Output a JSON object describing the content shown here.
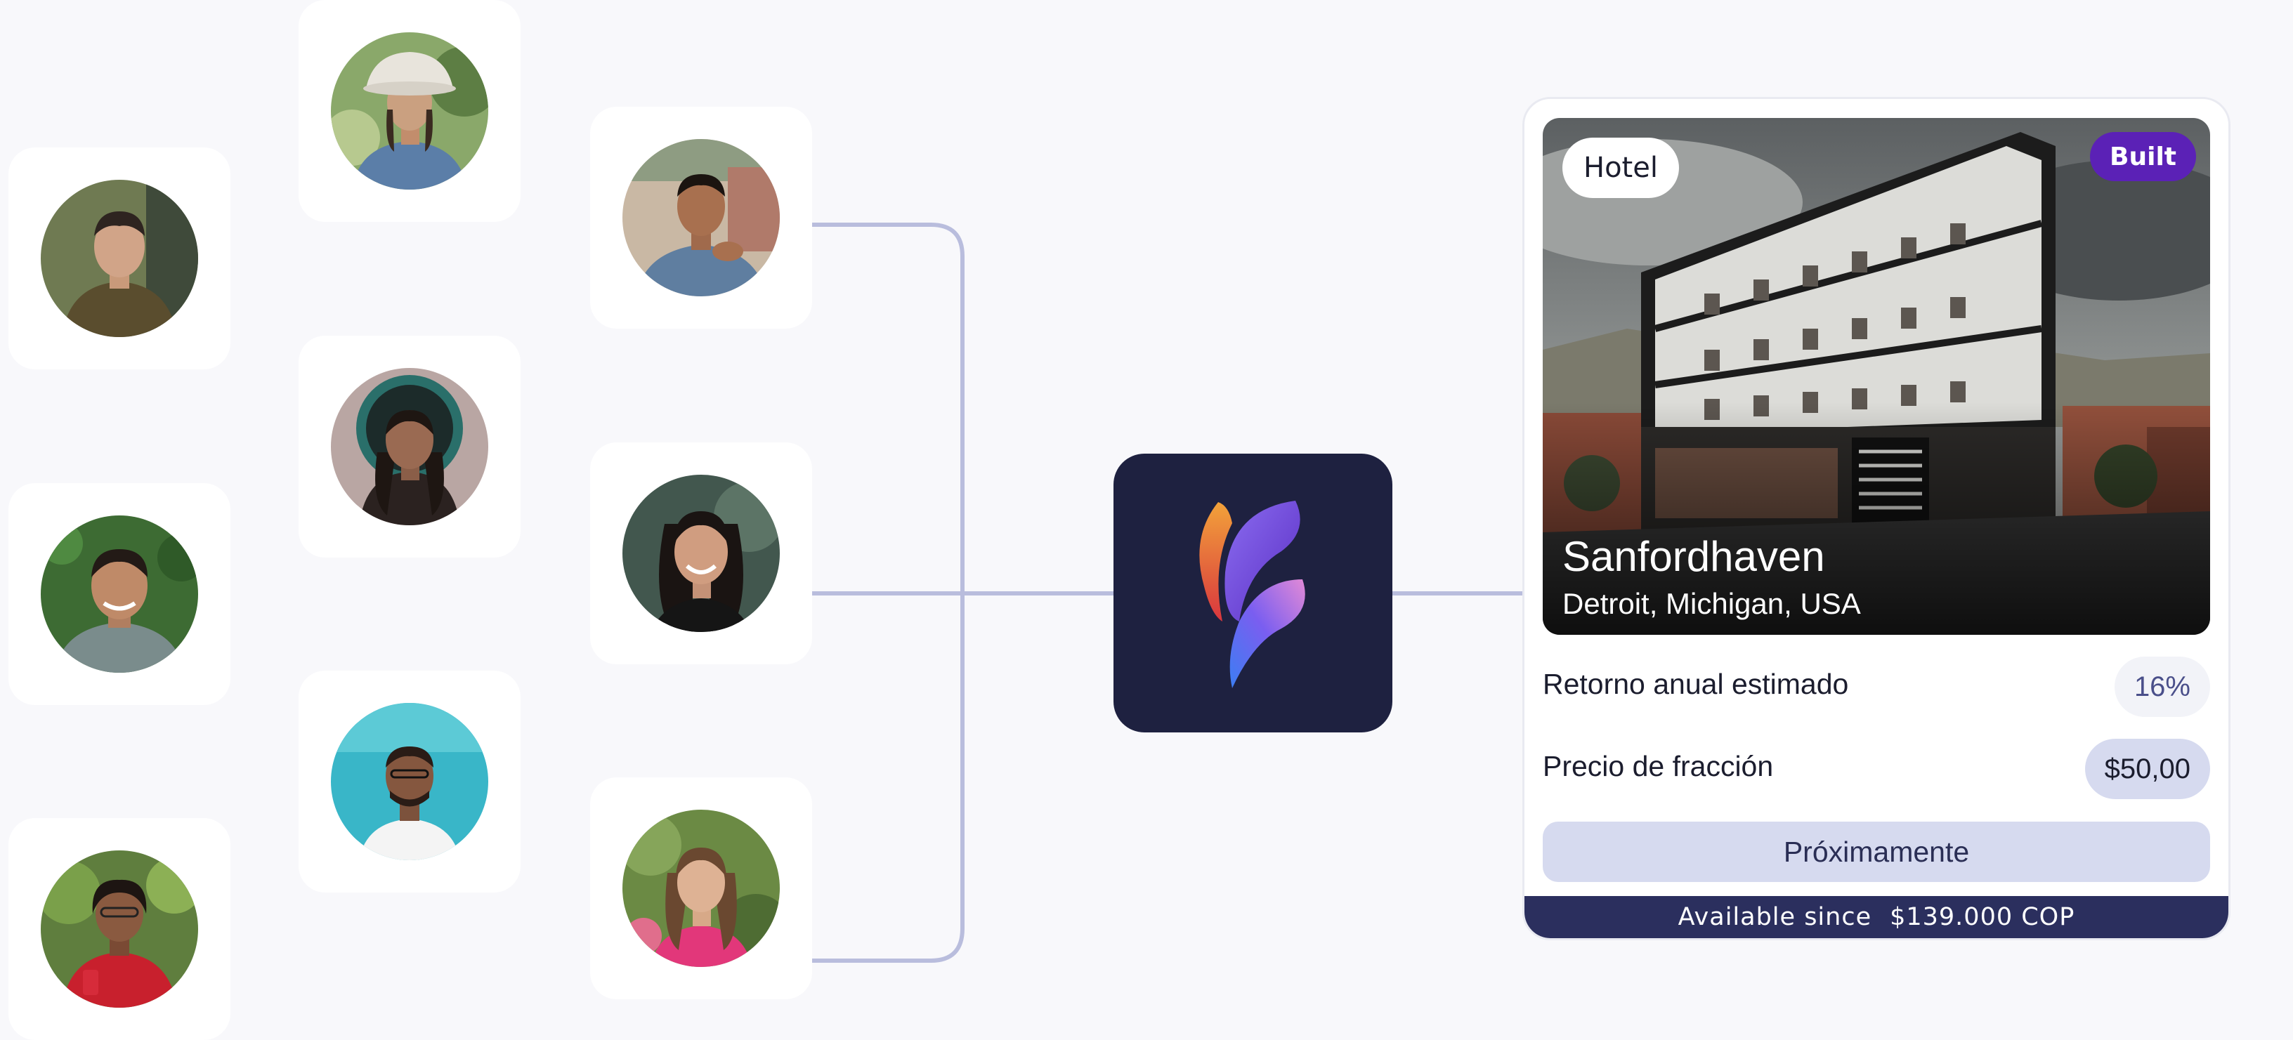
{
  "colors": {
    "background": "#f8f8fb",
    "connector": "#b9bddd",
    "logo_bg": "#1e2140",
    "badge": "#5b21b6",
    "footer": "#2b2f5e",
    "button": "#d6daef"
  },
  "avatars": [
    {
      "name": "avatar-man-jacket"
    },
    {
      "name": "avatar-man-green-background"
    },
    {
      "name": "avatar-woman-red-dress"
    },
    {
      "name": "avatar-woman-bucket-hat"
    },
    {
      "name": "avatar-woman-headdress"
    },
    {
      "name": "avatar-man-beach"
    },
    {
      "name": "avatar-man-street"
    },
    {
      "name": "avatar-woman-smiling"
    },
    {
      "name": "avatar-woman-garden"
    }
  ],
  "logo": {
    "icon": "feather-logo-icon"
  },
  "property": {
    "type": "Hotel",
    "status": "Built",
    "name": "Sanfordhaven",
    "location": "Detroit, Michigan, USA",
    "return_label": "Retorno anual estimado",
    "return_value": "16%",
    "price_label": "Precio de fracción",
    "price_value": "$50,00",
    "button_label": "Próximamente",
    "footer_label": "Available since",
    "footer_value": "$139.000 COP"
  }
}
